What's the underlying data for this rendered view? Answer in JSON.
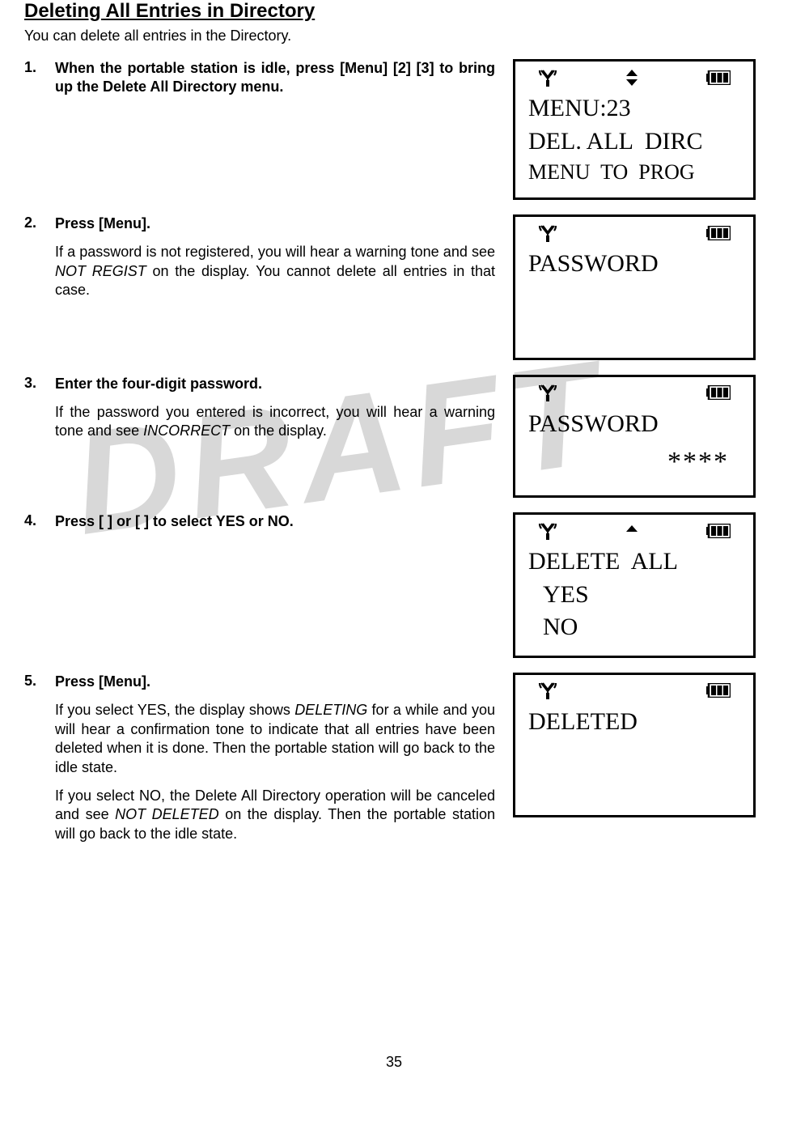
{
  "title": "Deleting All Entries in Directory",
  "intro": "You can delete all entries in the Directory.",
  "steps": [
    {
      "num": "1.",
      "bold": "When the portable station is idle, press [Menu] [2] [3] to bring up the Delete All Directory menu.",
      "body_html": "",
      "screen": {
        "arrows": "both",
        "lines": [
          {
            "text": "MENU:23",
            "cls": ""
          },
          {
            "text": "DEL. ALL  DIRC",
            "cls": ""
          },
          {
            "text": "MENU  TO  PROG",
            "cls": "small"
          }
        ]
      }
    },
    {
      "num": "2.",
      "bold": "Press [Menu].",
      "body_html": "If a password is not registered, you will hear a warning tone and see <em>NOT REGIST</em> on the display. You cannot delete all entries in that case.",
      "screen": {
        "arrows": "none",
        "lines": [
          {
            "text": "PASSWORD",
            "cls": ""
          },
          {
            "text": " ",
            "cls": ""
          },
          {
            "text": " ",
            "cls": ""
          }
        ]
      }
    },
    {
      "num": "3.",
      "bold": "Enter the four-digit password.",
      "body_html": "If the password you entered is incorrect, you will hear a warning tone and see <em>INCORRECT</em> on the display.",
      "screen": {
        "arrows": "none",
        "lines": [
          {
            "text": "PASSWORD",
            "cls": ""
          },
          {
            "text": "****",
            "cls": "stars"
          }
        ]
      }
    },
    {
      "num": "4.",
      "bold": "Press [   ] or [   ] to select YES or NO.",
      "body_html": "",
      "screen": {
        "arrows": "up",
        "lines": [
          {
            "text": "DELETE  ALL",
            "cls": ""
          },
          {
            "text": "YES",
            "cls": "indent"
          },
          {
            "text": "NO",
            "cls": "indent"
          }
        ]
      }
    },
    {
      "num": "5.",
      "bold": "Press [Menu].",
      "body_html": "If you select YES, the display shows <em>DELETING</em> for a while and you will hear a confirmation tone to indicate that all entries have been deleted when it is done. Then the portable station will go back to the idle state.",
      "body_html2": "If you select NO, the Delete All Directory operation will be canceled and see <em>NOT DELETED</em> on the display. Then the portable station will go back to the idle state.",
      "screen": {
        "arrows": "none",
        "lines": [
          {
            "text": "DELETED",
            "cls": ""
          },
          {
            "text": " ",
            "cls": ""
          },
          {
            "text": " ",
            "cls": ""
          }
        ]
      }
    }
  ],
  "page_num": "35",
  "watermark": "DRAFT"
}
